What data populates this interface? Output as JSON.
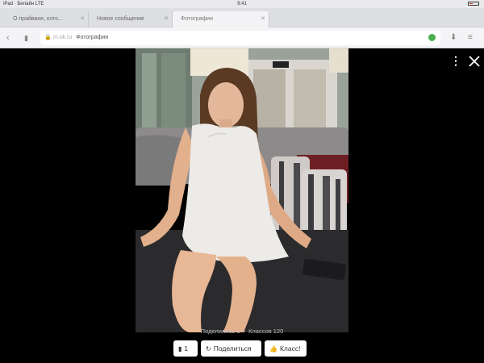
{
  "status_bar": {
    "carrier": "iPad · Билайн LTE",
    "time": "9:41"
  },
  "tabs": [
    {
      "label": "О прайване, кото..."
    },
    {
      "label": "Новое сообщение"
    },
    {
      "label": "Фотографии"
    }
  ],
  "address_bar": {
    "host": "m.ok.ru",
    "title": "Фотографии"
  },
  "viewer": {
    "stats": {
      "shares": "Поделились 1",
      "likes": "Классов 120"
    },
    "actions": {
      "comments": "1",
      "share": "Поделиться",
      "like": "Класс!"
    }
  },
  "icons": {
    "back": "chevron-left-icon",
    "forward": "chevron-right-icon",
    "more": "more-vertical-icon",
    "close": "close-icon",
    "comment": "comment-icon",
    "share": "share-icon",
    "like": "thumbs-up-icon"
  }
}
